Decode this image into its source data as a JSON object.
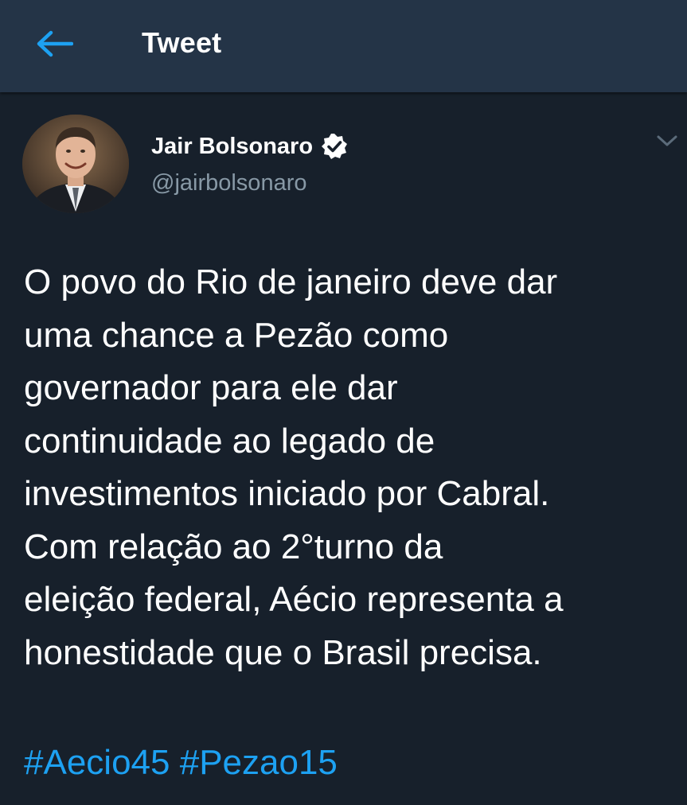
{
  "header": {
    "title": "Tweet",
    "back_icon": "arrow-left-icon"
  },
  "author": {
    "name": "Jair Bolsonaro",
    "handle": "@jairbolsonaro",
    "verified": true,
    "verified_icon": "verified-badge-icon"
  },
  "menu_icon": "chevron-down-icon",
  "tweet": {
    "lines": [
      "O povo do Rio de janeiro deve dar",
      "uma chance a Pezão como",
      "governador para ele dar",
      "continuidade ao legado de",
      "investimentos iniciado por Cabral.",
      "Com relação ao 2°turno da",
      "eleição federal, Aécio representa a",
      "honestidade que o Brasil precisa."
    ],
    "hashtags": [
      "#Aecio45",
      "#Pezao15"
    ]
  },
  "colors": {
    "background": "#17202b",
    "header": "#243447",
    "accent": "#1da1f2",
    "secondary_text": "#8899a6"
  }
}
